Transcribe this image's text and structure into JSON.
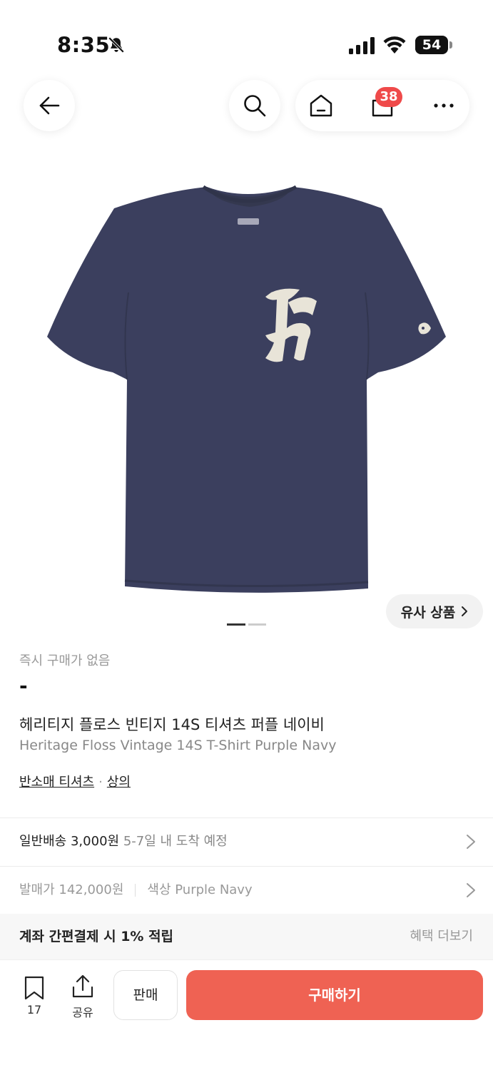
{
  "status_bar": {
    "time": "8:35",
    "battery": "54",
    "battery_level": 0.54
  },
  "header": {
    "cart_count": "38"
  },
  "gallery": {
    "similar_label": "유사 상품",
    "slide_index": 1,
    "slide_total": 2
  },
  "product": {
    "instant_status": "즉시 구매가 없음",
    "price": "-",
    "name_ko": "헤리티지 플로스 빈티지 14S 티셔츠 퍼플 네이비",
    "name_en": "Heritage Floss Vintage 14S T-Shirt Purple Navy",
    "categories": [
      "반소매 티셔츠",
      "상의"
    ],
    "category_separator": "·"
  },
  "shipping": {
    "label": "일반배송",
    "fee": "3,000원",
    "eta": "5-7일 내 도착 예정"
  },
  "details": {
    "release_price": "발매가 142,000원",
    "color": "색상 Purple Navy"
  },
  "benefit": {
    "text": "계좌 간편결제 시 1% 적립",
    "more": "혜택 더보기"
  },
  "bottom_bar": {
    "bookmark_count": "17",
    "share_label": "공유",
    "sell_label": "판매",
    "buy_label": "구매하기"
  },
  "colors": {
    "accent": "#ef6253",
    "badge": "#ef4a4a",
    "shirt": "#3b3f5e",
    "logo": "#e8e4d8"
  },
  "icons": [
    "bell-slash-icon",
    "signal-icon",
    "wifi-icon",
    "battery-icon",
    "back-arrow-icon",
    "search-icon",
    "home-icon",
    "shopping-bag-icon",
    "more-icon",
    "chevron-right-icon",
    "bookmark-icon",
    "share-icon"
  ]
}
